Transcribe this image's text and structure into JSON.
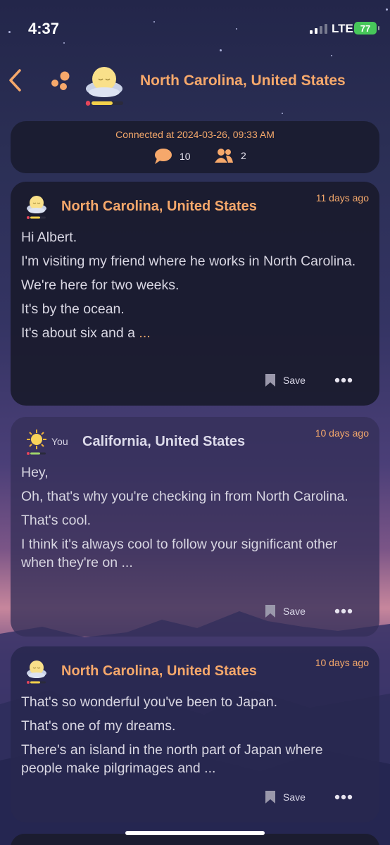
{
  "status_bar": {
    "time": "4:37",
    "network": "LTE",
    "battery": "77"
  },
  "header": {
    "title": "North Carolina, United States"
  },
  "info": {
    "connected": "Connected at 2024-03-26, 09:33 AM",
    "messages_count": "10",
    "people_count": "2"
  },
  "messages": [
    {
      "sender": "North Carolina, United States",
      "time_ago": "11 days ago",
      "lines": [
        "Hi Albert.",
        "I'm visiting my friend where he works in North Carolina.",
        "We're here for two weeks.",
        "It's by the ocean.",
        "It's about six and a "
      ],
      "ellipsis": "...",
      "save_label": "Save"
    },
    {
      "you_label": "You",
      "sender": "California, United States",
      "time_ago": "10 days ago",
      "lines": [
        "Hey,",
        "Oh, that's why you're checking in from North Carolina.",
        "That's cool.",
        "I think it's always cool to follow your significant other when they're on ..."
      ],
      "save_label": "Save"
    },
    {
      "sender": "North Carolina, United States",
      "time_ago": "10 days ago",
      "lines": [
        "That's so wonderful you've been to Japan.",
        "That's one of my dreams.",
        "There's an island in the north part of Japan where people make pilgrimages and ..."
      ],
      "save_label": "Save"
    }
  ],
  "colors": {
    "accent": "#f6a86b",
    "card_bg": "#1a1b2e",
    "text": "#d8d6e2",
    "battery": "#47c75a"
  },
  "icons": [
    "back-chevron-icon",
    "bubbles-icon",
    "moon-avatar-icon",
    "speech-bubble-icon",
    "people-icon",
    "bookmark-icon",
    "more-dots-icon",
    "sun-avatar-icon"
  ]
}
